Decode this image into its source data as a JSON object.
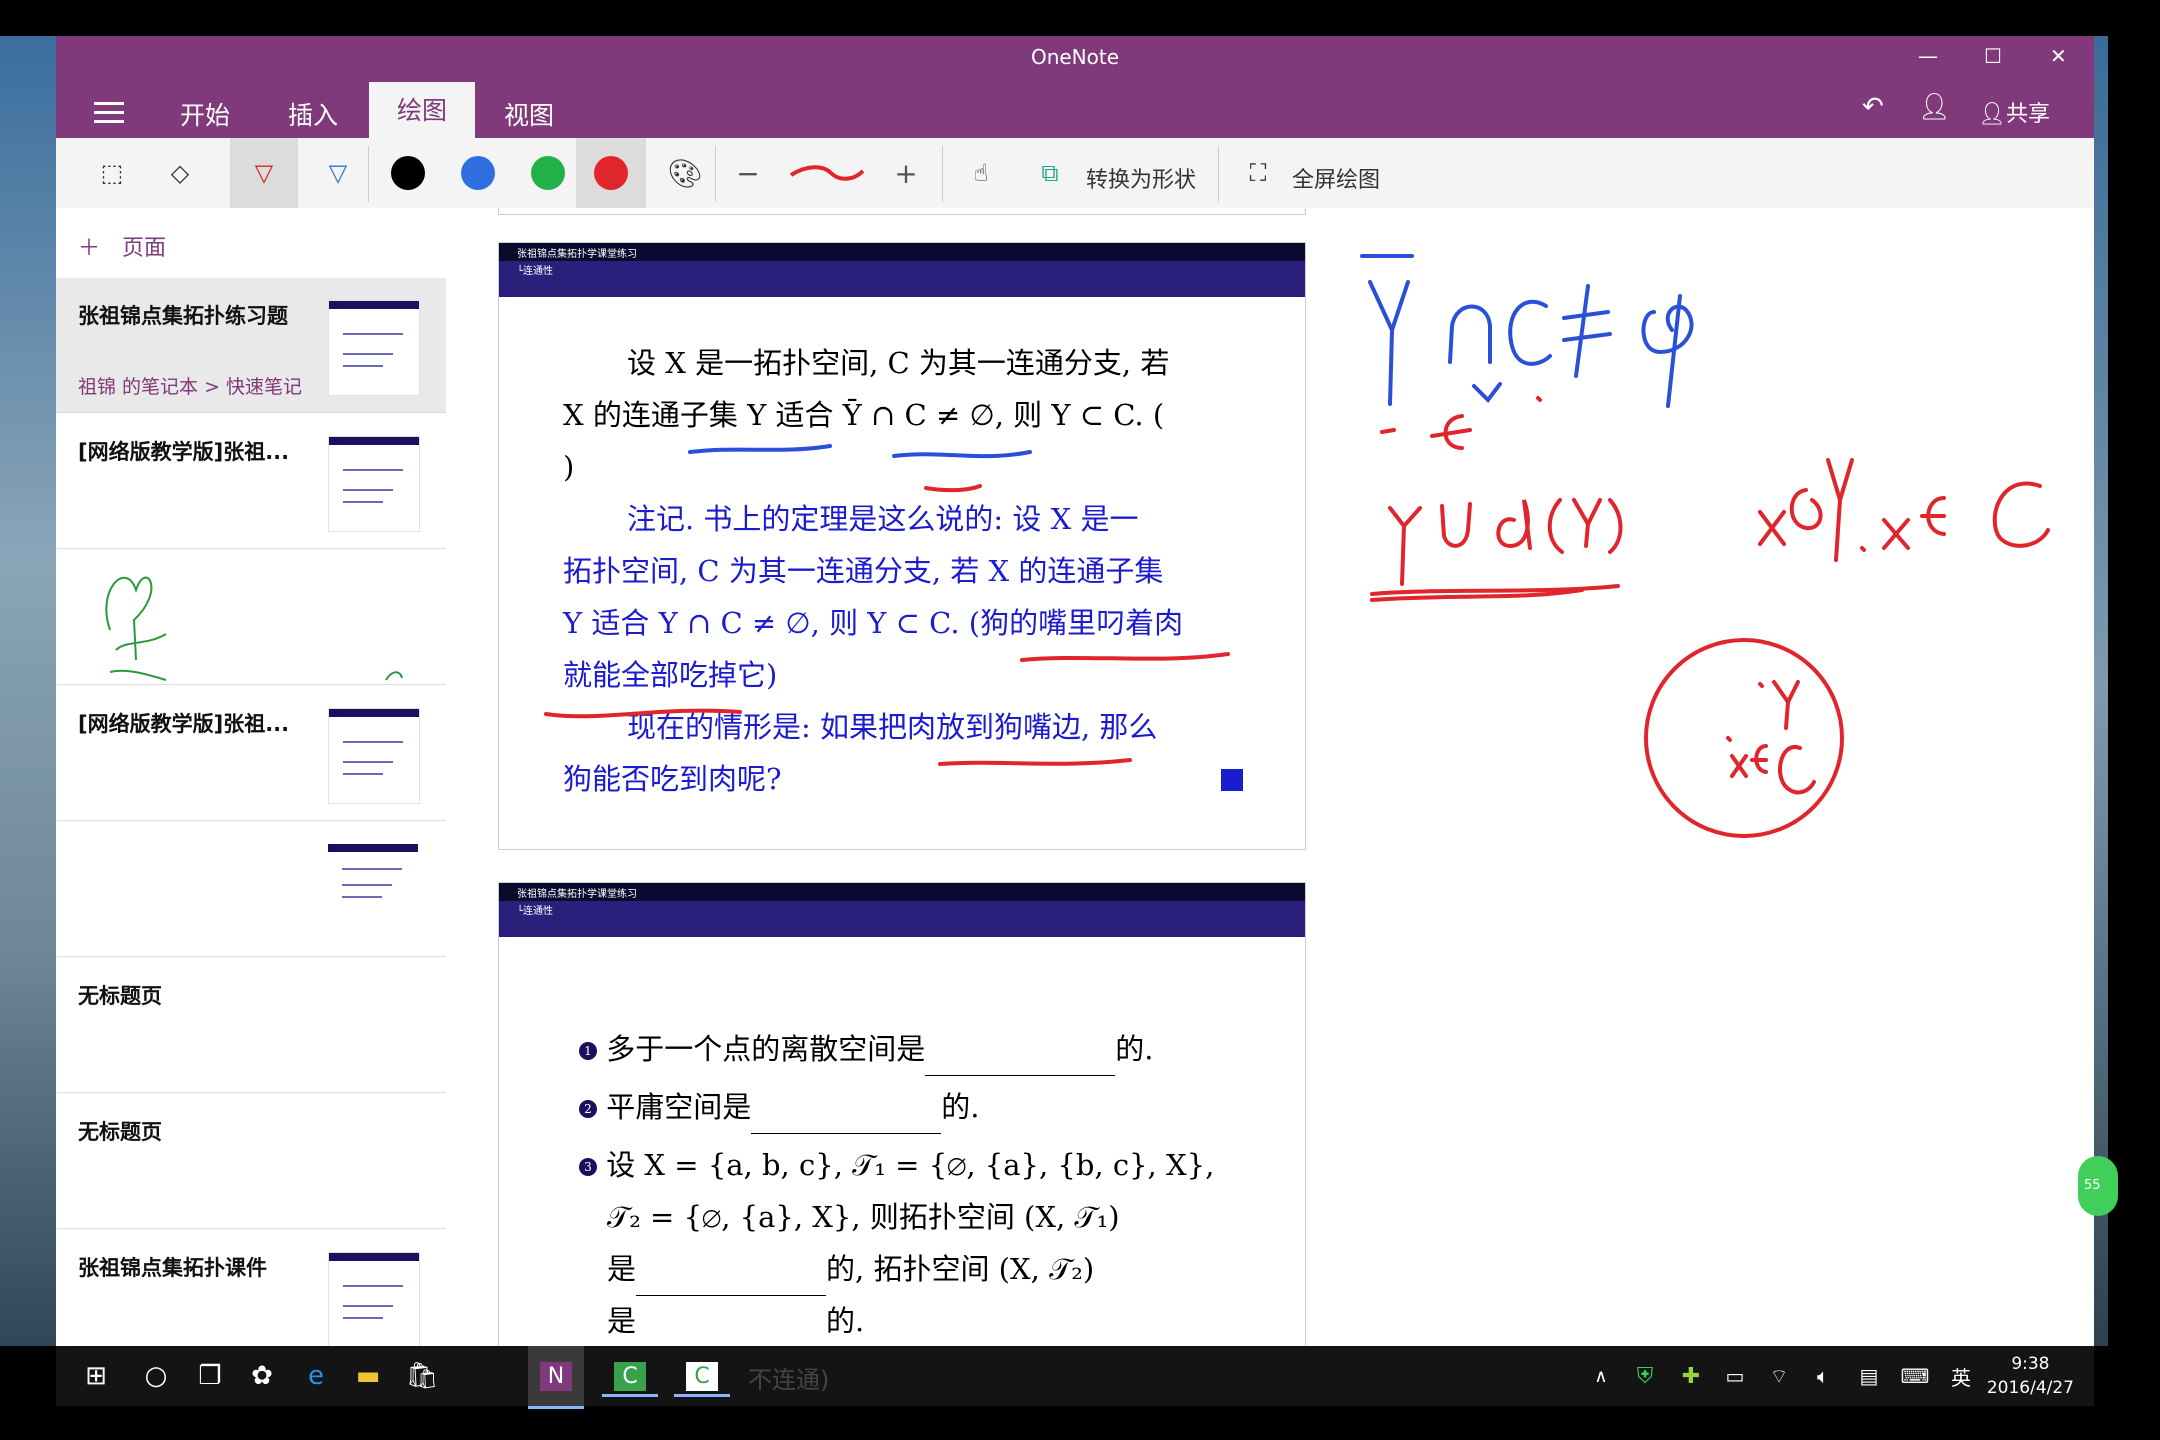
{
  "app": {
    "title": "OneNote"
  },
  "tabs": [
    {
      "label": "开始"
    },
    {
      "label": "插入"
    },
    {
      "label": "绘图"
    },
    {
      "label": "视图"
    }
  ],
  "header": {
    "share_label": "共享"
  },
  "toolbar": {
    "convert_label": "转换为形状",
    "fullscreen_label": "全屏绘图",
    "colors": [
      "#000000",
      "#2f6fe0",
      "#22b24a",
      "#e0252c"
    ]
  },
  "sidebar": {
    "add_page_label": "页面",
    "pages": [
      {
        "title": "张祖锦点集拓扑练习题",
        "crumb": "祖锦 的笔记本 > 快速笔记"
      },
      {
        "title": "[网络版教学版]张祖..."
      },
      {
        "title": ""
      },
      {
        "title": "[网络版教学版]张祖..."
      },
      {
        "title": ""
      },
      {
        "title": "无标题页"
      },
      {
        "title": "无标题页"
      },
      {
        "title": "张祖锦点集拓扑课件"
      }
    ]
  },
  "slide1": {
    "header_title": "张祖锦点集拓扑学课堂练习",
    "header_sub": "└连通性",
    "lines": [
      "设 X 是一拓扑空间, C 为其一连通分支, 若",
      "X 的连通子集 Y 适合 Ȳ ∩ C ≠ ∅, 则 Y ⊂ C. (",
      ")",
      "注记. 书上的定理是这么说的: 设 X 是一",
      "拓扑空间, C 为其一连通分支, 若 X 的连通子集",
      "Y 适合 Y ∩ C ≠ ∅, 则 Y ⊂ C. (狗的嘴里叼着肉",
      "就能全部吃掉它)",
      "现在的情形是: 如果把肉放到狗嘴边, 那么",
      "狗能否吃到肉呢?"
    ]
  },
  "slide2": {
    "header_title": "张祖锦点集拓扑学课堂练习",
    "header_sub": "└连通性",
    "items": [
      {
        "num": "1",
        "text": "多于一个点的离散空间是",
        "suffix": "的."
      },
      {
        "num": "2",
        "text": "平庸空间是",
        "suffix": "的."
      },
      {
        "num": "3",
        "text": "设 X = {a, b, c}, 𝒯₁ = {∅, {a}, {b, c}, X},"
      }
    ],
    "lines_extra": [
      "𝒯₂ = {∅, {a}, X}, 则拓扑空间 (X, 𝒯₁)",
      "是",
      "的, 拓扑空间 (X, 𝒯₂)",
      "是",
      "的."
    ],
    "cutoff": "不连通)"
  },
  "ink": {
    "blue_formula": "Ȳ∩C≠φ",
    "red_text1": "YUd(Y)",
    "red_text2": "x∈Ȳ, x∈C",
    "circle_labels": [
      "·Y",
      "·x∈C"
    ]
  },
  "taskbar": {
    "ime": "英",
    "time": "9:38",
    "date": "2016/4/27",
    "badge": "55"
  }
}
